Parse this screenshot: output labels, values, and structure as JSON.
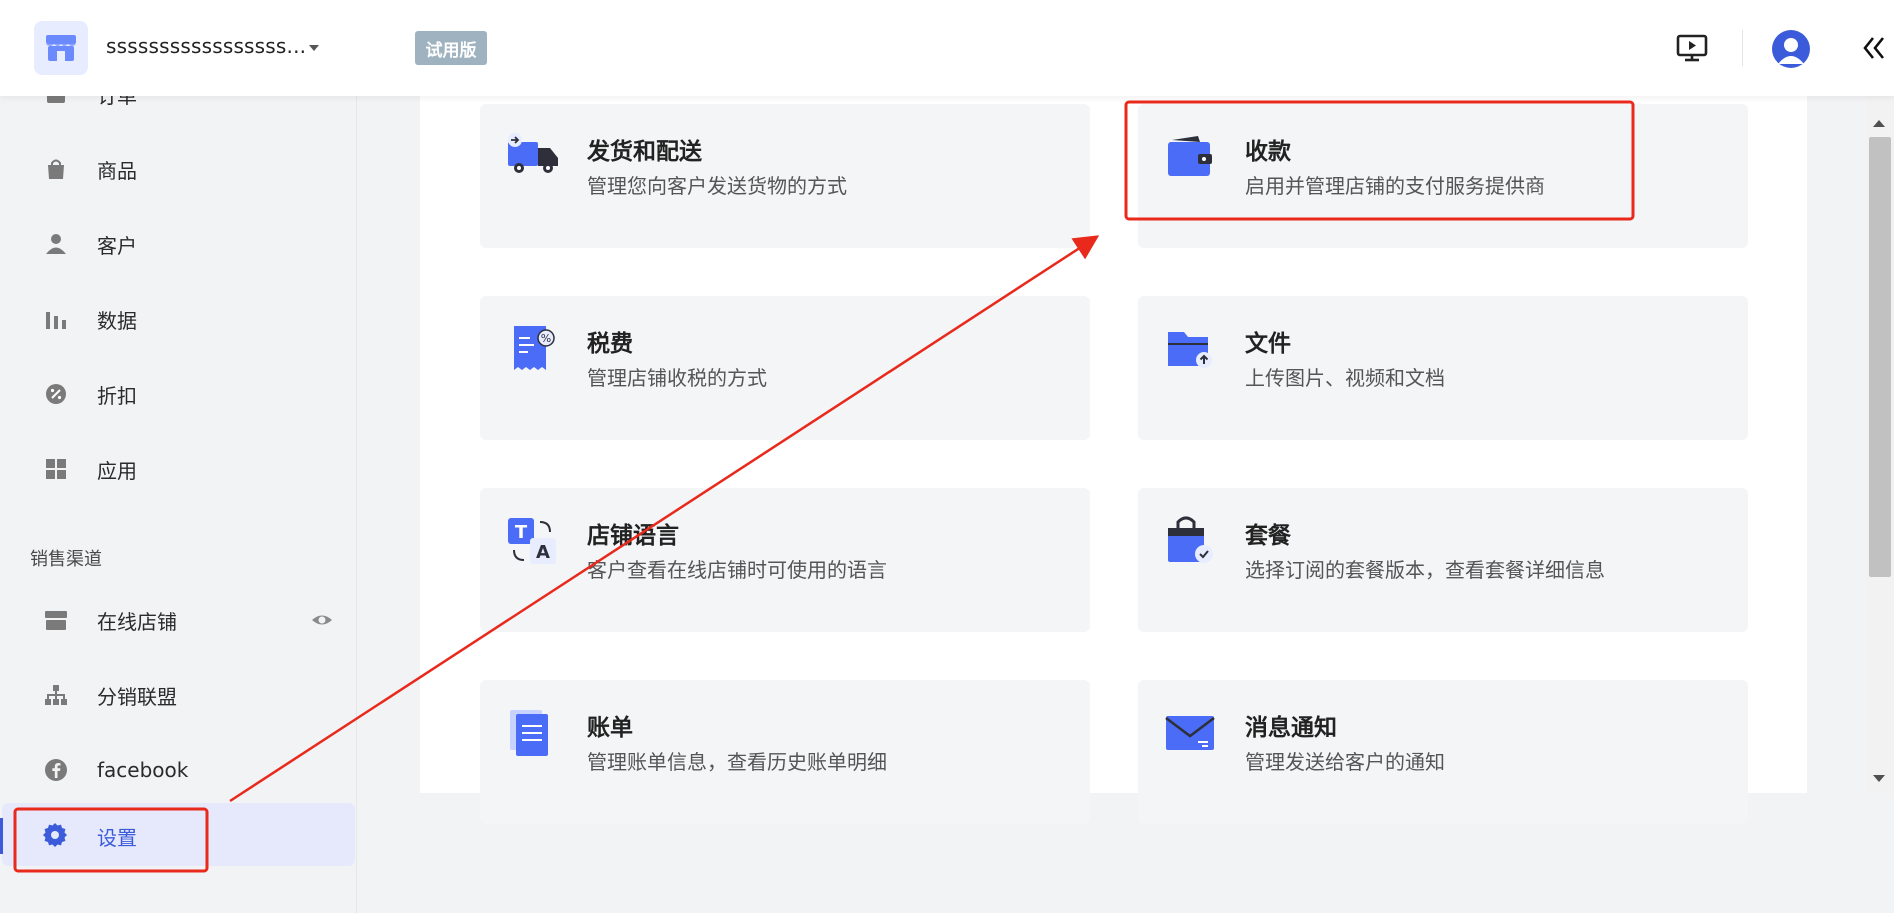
{
  "header": {
    "store_name": "sssssssssssssssss...",
    "trial_badge": "试用版"
  },
  "sidebar": {
    "items": [
      {
        "label": "订单",
        "icon": "orders-icon"
      },
      {
        "label": "商品",
        "icon": "shopping-bag-icon"
      },
      {
        "label": "客户",
        "icon": "customer-icon"
      },
      {
        "label": "数据",
        "icon": "bar-chart-icon"
      },
      {
        "label": "折扣",
        "icon": "discount-icon"
      },
      {
        "label": "应用",
        "icon": "apps-grid-icon"
      }
    ],
    "section_title": "销售渠道",
    "channels": [
      {
        "label": "在线店铺",
        "icon": "storefront-icon"
      },
      {
        "label": "分销联盟",
        "icon": "affiliate-tree-icon"
      },
      {
        "label": "facebook",
        "icon": "facebook-icon"
      }
    ],
    "settings_label": "设置"
  },
  "cards": [
    {
      "title": "发货和配送",
      "desc": "管理您向客户发送货物的方式",
      "icon": "delivery-truck-icon"
    },
    {
      "title": "收款",
      "desc": "启用并管理店铺的支付服务提供商",
      "icon": "wallet-icon"
    },
    {
      "title": "税费",
      "desc": "管理店铺收税的方式",
      "icon": "tax-receipt-icon"
    },
    {
      "title": "文件",
      "desc": "上传图片、视频和文档",
      "icon": "folder-upload-icon"
    },
    {
      "title": "店铺语言",
      "desc": "客户查看在线店铺时可使用的语言",
      "icon": "translate-icon"
    },
    {
      "title": "套餐",
      "desc": "选择订阅的套餐版本，查看套餐详细信息",
      "icon": "plan-bag-icon"
    },
    {
      "title": "账单",
      "desc": "管理账单信息，查看历史账单明细",
      "icon": "bill-document-icon"
    },
    {
      "title": "消息通知",
      "desc": "管理发送给客户的通知",
      "icon": "mail-icon"
    }
  ],
  "colors": {
    "accent": "#3b5bdb",
    "icon_blue": "#4a6cf7",
    "annotation_red": "#e8291c"
  }
}
